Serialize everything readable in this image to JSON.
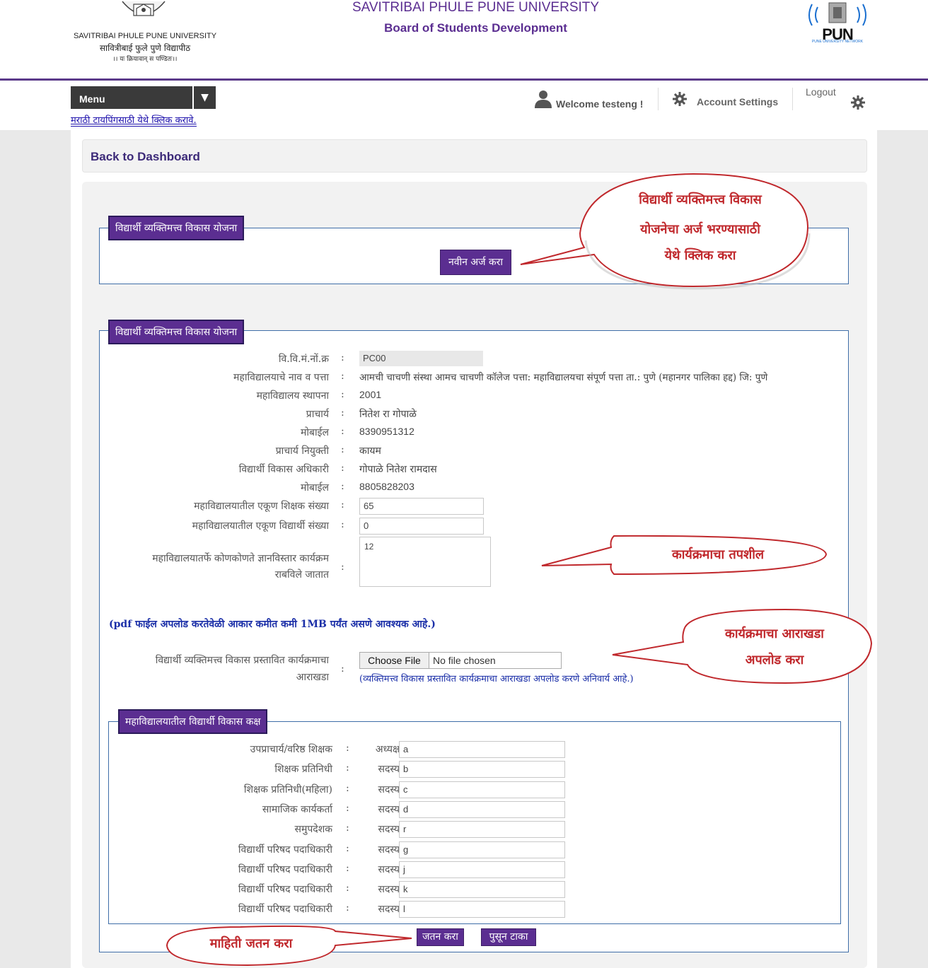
{
  "header": {
    "logo_text": [
      "SAVITRIBAI PHULE PUNE UNIVERSITY",
      "सावित्रीबाई फुले पुणे विद्यापीठ",
      "।। यः क्रियावान् स पण्डितः।।"
    ],
    "title": "SAVITRIBAI PHULE PUNE UNIVERSITY",
    "subtitle": "Board of Students Development",
    "network_logo_text": "PUN",
    "network_logo_caption": "PUNE UNIVERSITY NETWORK"
  },
  "nav": {
    "menu_label": "Menu",
    "welcome": "Welcome testeng !",
    "account_settings": "Account Settings",
    "logout": "Logout",
    "marathi_typing_link": "मराठी टायपिंगसाठी येथे क्लिक करावे."
  },
  "back_to_dashboard": "Back to Dashboard",
  "section1": {
    "legend": "विद्यार्थी व्यक्तिमत्त्व विकास योजना",
    "new_application_button": "नवीन अर्ज करा",
    "callout": [
      "विद्यार्थी व्यक्तिमत्त्व विकास",
      "योजनेचा अर्ज भरण्यासाठी",
      "येथे क्लिक करा"
    ]
  },
  "section2": {
    "legend": "विद्यार्थी व्यक्तिमत्त्व विकास योजना",
    "fields": {
      "code_label": "वि.वि.मं.नों.क्र",
      "code_value": "PC00",
      "college_label": "महाविद्यालयाचे नाव व पत्ता",
      "college_value": "आमची चाचणी संस्था आमच चाचणी कॉलेज पत्ता: महाविद्यालयचा संपूर्ण पत्ता ता.: पुणे (महानगर पालिका हद्द) जि: पुणे",
      "established_label": "महाविद्यालय स्थापना",
      "established_value": "2001",
      "principal_label": "प्राचार्य",
      "principal_value": "नितेश रा गोपाळे",
      "mobile1_label": "मोबाईल",
      "mobile1_value": "8390951312",
      "appointment_label": "प्राचार्य नियुक्ती",
      "appointment_value": "कायम",
      "officer_label": "विद्यार्थी विकास अधिकारी",
      "officer_value": "गोपाळे नितेश रामदास",
      "mobile2_label": "मोबाईल",
      "mobile2_value": "8805828203",
      "teachers_label": "महाविद्यालयातील एकूण शिक्षक संख्या",
      "teachers_value": "65",
      "students_label": "महाविद्यालयातील एकूण विद्यार्थी संख्या",
      "students_value": "0",
      "programs_label": [
        "महाविद्यालयातर्फे कोणकोणते ज्ञानविस्तार कार्यक्रम",
        "राबविले जातात"
      ],
      "programs_value": "12"
    },
    "callout_programs": "कार्यक्रमाचा तपशील",
    "pdf_note": "(pdf फाईल अपलोड करतेवेळी आकार कमीत कमी 1MB पर्यंत असणे आवश्यक आहे.)",
    "upload_label": [
      "विद्यार्थी व्यक्तिमत्त्व विकास प्रस्तावित कार्यक्रमाचा",
      "आराखडा"
    ],
    "choose_file": "Choose File",
    "no_file": "No file chosen",
    "upload_note": "(व्यक्तिमत्त्व विकास प्रस्तावित कार्यक्रमाचा आराखडा अपलोड करणे अनिवार्य आहे.)",
    "callout_upload": [
      "कार्यक्रमाचा आराखडा",
      "अपलोड करा"
    ]
  },
  "committee": {
    "legend": "महाविद्यालयातील विद्यार्थी विकास कक्ष",
    "rows": [
      {
        "label": "उपप्राचार्य/वरिष्ठ शिक्षक",
        "role": "अध्यक्ष",
        "value": "a"
      },
      {
        "label": "शिक्षक प्रतिनिधी",
        "role": "सदस्य",
        "value": "b"
      },
      {
        "label": "शिक्षक प्रतिनिधी(महिला)",
        "role": "सदस्य",
        "value": "c"
      },
      {
        "label": "सामाजिक कार्यकर्ता",
        "role": "सदस्य",
        "value": "d"
      },
      {
        "label": "समुपदेशक",
        "role": "सदस्य",
        "value": "r"
      },
      {
        "label": "विद्यार्थी परिषद पदाधिकारी",
        "role": "सदस्य",
        "value": "g"
      },
      {
        "label": "विद्यार्थी परिषद पदाधिकारी",
        "role": "सदस्य",
        "value": "j"
      },
      {
        "label": "विद्यार्थी परिषद पदाधिकारी",
        "role": "सदस्य",
        "value": "k"
      },
      {
        "label": "विद्यार्थी परिषद पदाधिकारी",
        "role": "सदस्य",
        "value": "l"
      }
    ]
  },
  "actions": {
    "save_button": "जतन करा",
    "clear_button": "पुसून टाका",
    "callout_save": "माहिती जतन करा"
  },
  "colors": {
    "brand_purple": "#5b2e91",
    "callout_red": "#c0282c",
    "note_blue": "#1b2fa8"
  }
}
